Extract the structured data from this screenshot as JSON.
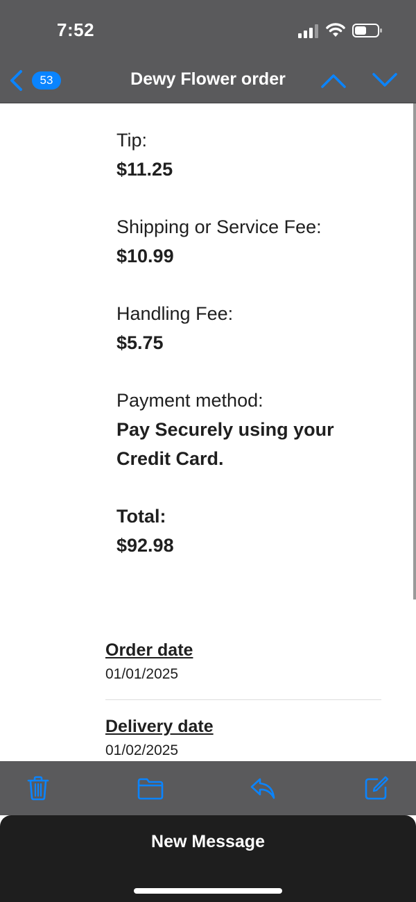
{
  "status_bar": {
    "time": "7:52"
  },
  "nav": {
    "unread_count": "53",
    "title": "Dewy Flower order"
  },
  "order_summary": {
    "tip_label": "Tip:",
    "tip_value": "$11.25",
    "shipping_label": "Shipping or Service Fee:",
    "shipping_value": "$10.99",
    "handling_label": "Handling Fee:",
    "handling_value": "$5.75",
    "payment_label": "Payment method:",
    "payment_value_line1": "Pay Securely using your",
    "payment_value_line2": "Credit Card.",
    "total_label": "Total:",
    "total_value": "$92.98"
  },
  "dates": {
    "order_label": "Order date",
    "order_value": "01/01/2025",
    "delivery_label": "Delivery date",
    "delivery_value": "01/02/2025"
  },
  "toolbar": {
    "icons": [
      "trash-icon",
      "folder-icon",
      "reply-icon",
      "compose-icon"
    ]
  },
  "draft": {
    "title": "New Message"
  },
  "colors": {
    "accent": "#0a84ff",
    "bar_background": "#5a5a5c",
    "body_text": "#1f1f1f",
    "sheet_background": "#1e1e1e"
  }
}
